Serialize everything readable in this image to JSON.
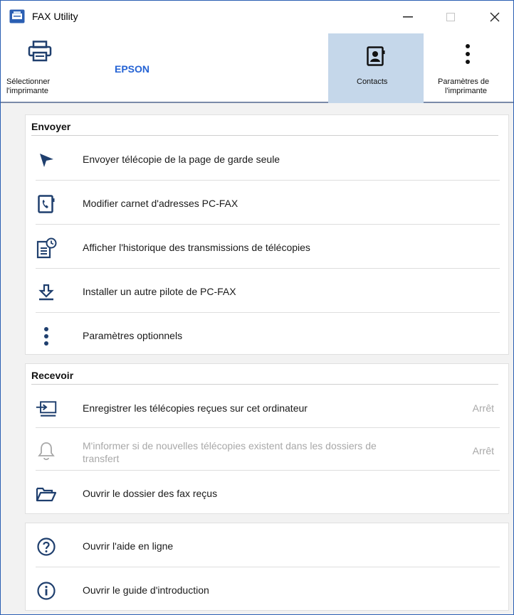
{
  "window": {
    "title": "FAX Utility",
    "accent": "#2b5fb3"
  },
  "toolbar": {
    "select_printer_label_1": "Sélectionner",
    "select_printer_label_2": "l'imprimante",
    "printer_name": "EPSON",
    "contacts_label": "Contacts",
    "printer_settings_label_1": "Paramètres de",
    "printer_settings_label_2": "l'imprimante",
    "selected_tab": "Contacts",
    "printer_name_color": "#2563d4",
    "selected_bg": "#c5d7ea"
  },
  "send": {
    "title": "Envoyer",
    "items": [
      {
        "label": "Envoyer télécopie de la page de garde seule",
        "icon": "send-arrow-icon"
      },
      {
        "label": "Modifier carnet d'adresses PC-FAX",
        "icon": "phonebook-icon"
      },
      {
        "label": "Afficher l'historique des transmissions de télécopies",
        "icon": "history-icon"
      },
      {
        "label": "Installer un autre pilote de PC-FAX",
        "icon": "download-icon"
      },
      {
        "label": "Paramètres optionnels",
        "icon": "more-vertical-icon"
      }
    ]
  },
  "receive": {
    "title": "Recevoir",
    "items": [
      {
        "label": "Enregistrer les télécopies reçues sur cet ordinateur",
        "state": "Arrêt",
        "icon": "save-to-pc-icon"
      },
      {
        "label_line1": "M'informer si de nouvelles télécopies existent dans les dossiers de",
        "label_line2": "transfert",
        "state": "Arrêt",
        "icon": "bell-icon",
        "disabled": true
      },
      {
        "label": "Ouvrir le dossier des fax reçus",
        "icon": "folder-open-icon"
      }
    ]
  },
  "help": {
    "items": [
      {
        "label": "Ouvrir l'aide en ligne",
        "icon": "help-circle-icon"
      },
      {
        "label": "Ouvrir le guide d'introduction",
        "icon": "info-circle-icon"
      }
    ]
  }
}
